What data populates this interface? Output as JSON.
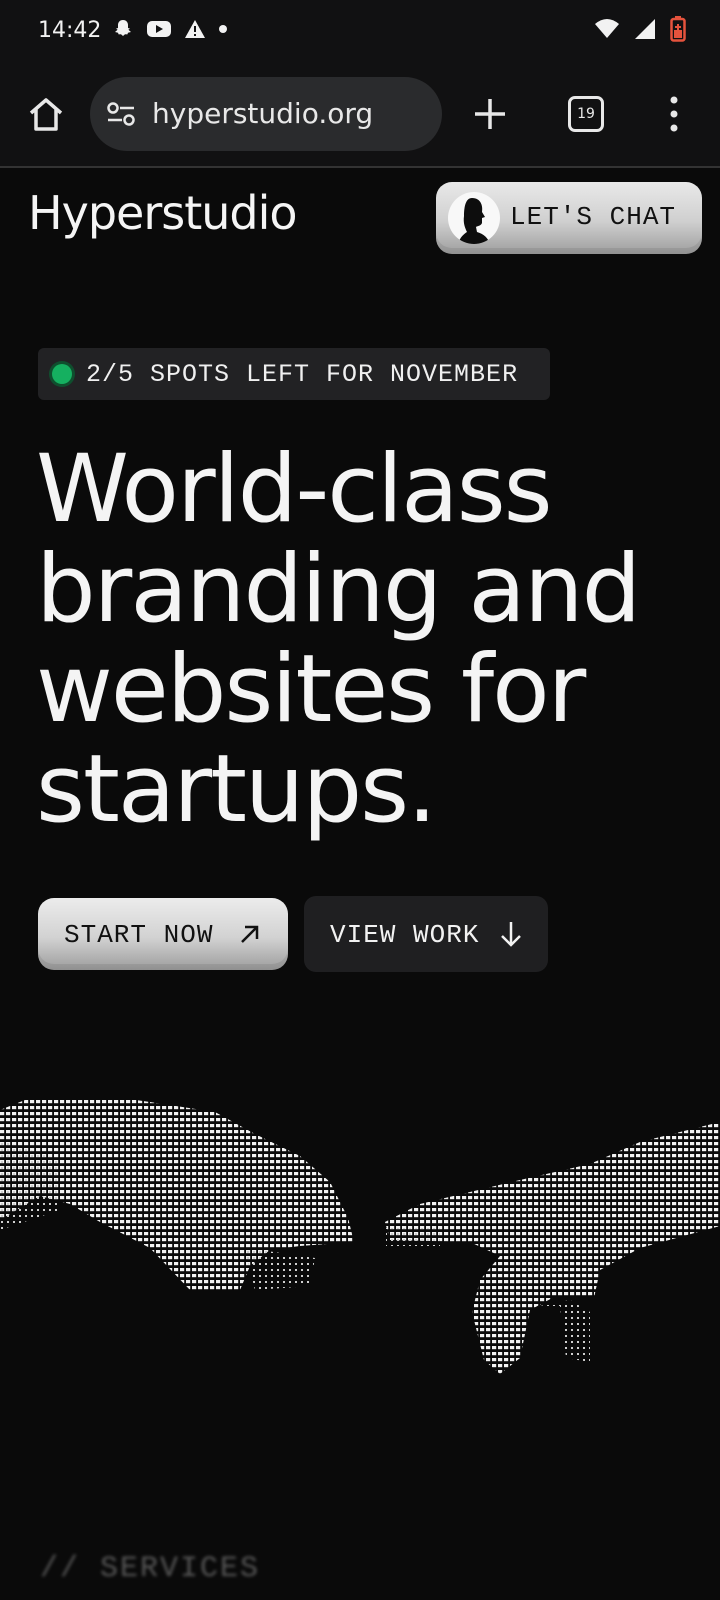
{
  "status_bar": {
    "time": "14:42",
    "left_icons": [
      "snapchat-icon",
      "youtube-icon",
      "warning-icon",
      "dot-icon"
    ],
    "right_icons": [
      "wifi-icon",
      "signal-icon",
      "battery-charging-icon"
    ],
    "battery_color": "#e5533d"
  },
  "browser": {
    "url": "hyperstudio.org",
    "tab_count": "19"
  },
  "site": {
    "logo": "Hyperstudio",
    "chat_button": "LET'S CHAT",
    "badge": "2/5 SPOTS LEFT FOR NOVEMBER",
    "badge_dot_color": "#15b060",
    "headline_lines": [
      "World-class",
      "branding and",
      "websites for",
      "startups."
    ],
    "primary_cta": "START NOW",
    "secondary_cta": "VIEW WORK",
    "section_label": "// SERVICES"
  }
}
